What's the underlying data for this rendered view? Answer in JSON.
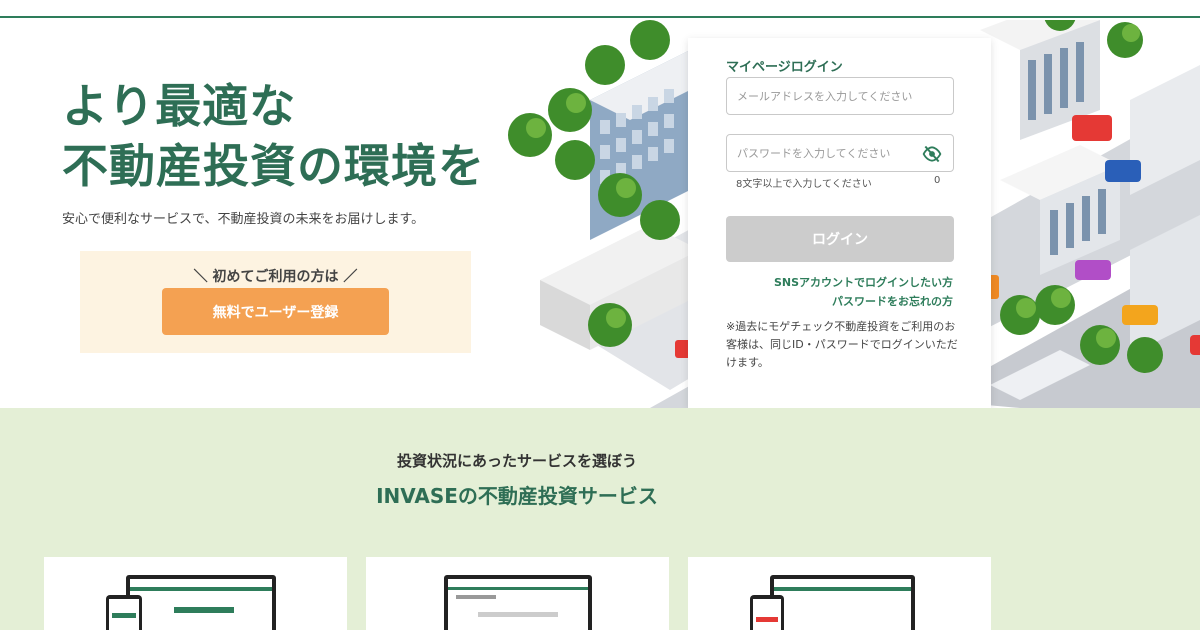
{
  "hero": {
    "headline_line1": "より最適な",
    "headline_line2": "不動産投資の環境を",
    "subtext": "安心で便利なサービスで、不動産投資の未来をお届けします。",
    "promo_caption": "＼ 初めてご利用の方は ／",
    "register_label": "無料でユーザー登録"
  },
  "login": {
    "title": "マイページログイン",
    "email_placeholder": "メールアドレスを入力してください",
    "password_placeholder": "パスワードを入力してください",
    "password_hint": "8文字以上で入力してください",
    "password_count": "0",
    "login_label": "ログイン",
    "sns_link": "SNSアカウントでログインしたい方",
    "forgot_link": "パスワードをお忘れの方",
    "note": "※過去にモゲチェック不動産投資をご利用のお客様は、同じID・パスワードでログインいただけます。"
  },
  "services": {
    "subtitle": "投資状況にあったサービスを選ぼう",
    "title": "INVASEの不動産投資サービス"
  },
  "colors": {
    "brand_green": "#2e6e55",
    "accent_orange": "#f4a152",
    "promo_bg": "#fdf3e1",
    "services_bg": "#e4efd6"
  }
}
